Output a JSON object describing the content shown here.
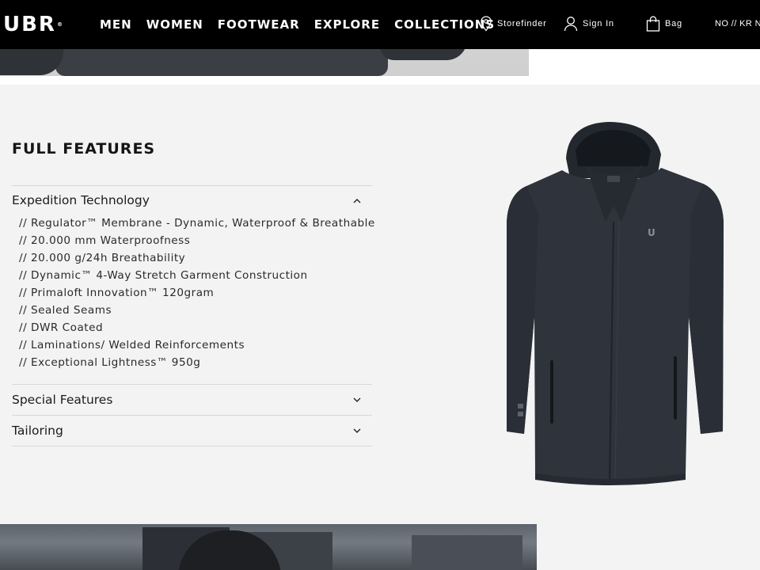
{
  "brand": {
    "logo_text": "UBR",
    "logo_mark": "®"
  },
  "nav": {
    "menu": [
      "MEN",
      "WOMEN",
      "FOOTWEAR",
      "EXPLORE",
      "COLLECTIONS"
    ],
    "storefinder": "Storefinder",
    "sign_in": "Sign In",
    "bag": "Bag",
    "currency": "NO // KR N"
  },
  "features": {
    "title": "FULL FEATURES",
    "sections": [
      {
        "label": "Expedition Technology",
        "expanded": true,
        "items": [
          "// Regulator™ Membrane - Dynamic, Waterproof & Breathable",
          "// 20.000 mm Waterproofness",
          "// 20.000 g/24h Breathability",
          "// Dynamic™ 4-Way Stretch Garment Construction",
          "// Primaloft Innovation™ 120gram",
          "// Sealed Seams",
          "// DWR Coated",
          "// Laminations/ Welded Reinforcements",
          "// Exceptional Lightness™ 950g"
        ]
      },
      {
        "label": "Special Features",
        "expanded": false
      },
      {
        "label": "Tailoring",
        "expanded": false
      }
    ]
  },
  "product_image": {
    "logo_on_coat": "U"
  },
  "colors": {
    "nav_bg": "#000000",
    "page_bg": "#f3f3f3",
    "jacket": "#2e333c"
  }
}
